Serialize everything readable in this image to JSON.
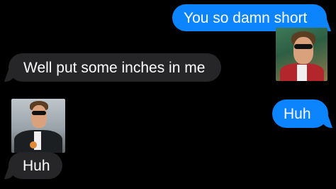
{
  "messages": [
    {
      "id": "b1",
      "direction": "sent",
      "text": "You so damn short"
    },
    {
      "id": "b2",
      "direction": "received",
      "text": "Well put some inches in me"
    },
    {
      "id": "b3",
      "direction": "sent",
      "text": "Huh"
    },
    {
      "id": "b4",
      "direction": "received",
      "text": "Huh"
    }
  ],
  "colors": {
    "background": "#000000",
    "sent_bubble": "#0b84fe",
    "received_bubble": "#262628",
    "text": "#ffffff"
  }
}
